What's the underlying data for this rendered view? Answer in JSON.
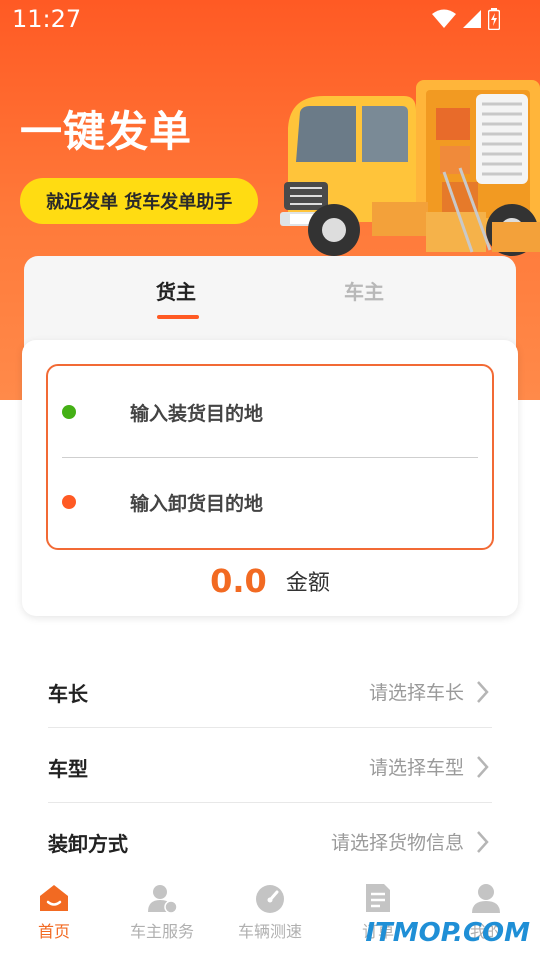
{
  "status_bar": {
    "time": "11:27"
  },
  "hero": {
    "title": "一键发单",
    "tagline": "就近发单 货车发单助手"
  },
  "role_tabs": [
    {
      "label": "货主",
      "active": true
    },
    {
      "label": "车主",
      "active": false
    }
  ],
  "route": {
    "load_placeholder": "输入装货目的地",
    "unload_placeholder": "输入卸货目的地",
    "load_dot_color": "#44b015",
    "unload_dot_color": "#ff5a24"
  },
  "amount": {
    "value": "0.0",
    "label": "金额"
  },
  "form": {
    "rows": [
      {
        "label": "车长",
        "value": "请选择车长"
      },
      {
        "label": "车型",
        "value": "请选择车型"
      },
      {
        "label": "装卸方式",
        "value": "请选择货物信息"
      }
    ]
  },
  "tabbar": {
    "items": [
      {
        "label": "首页",
        "icon": "home-icon",
        "active": true
      },
      {
        "label": "车主服务",
        "icon": "driver-service-icon",
        "active": false
      },
      {
        "label": "车辆测速",
        "icon": "speedometer-icon",
        "active": false
      },
      {
        "label": "订单",
        "icon": "order-document-icon",
        "active": false
      },
      {
        "label": "我的",
        "icon": "profile-icon",
        "active": false
      }
    ]
  },
  "watermark": "ITMOP.COM",
  "colors": {
    "accent": "#ff5a24",
    "pill": "#ffdc12",
    "amount": "#f26a22"
  }
}
